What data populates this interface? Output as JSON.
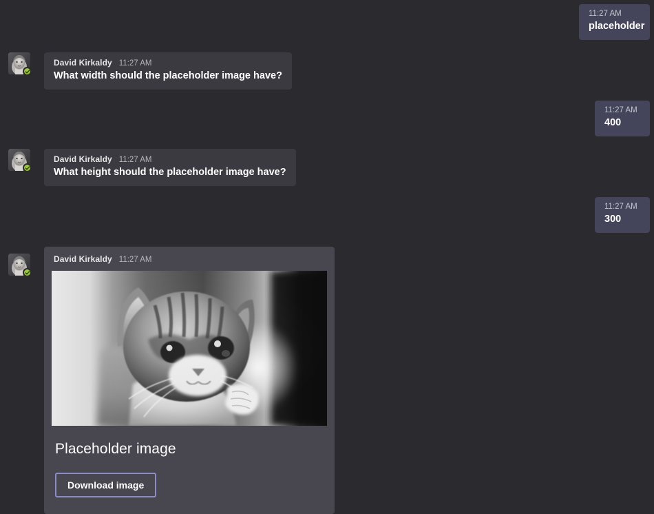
{
  "theme": {
    "page_background": "#2b2a2f",
    "incoming_bubble": "#3b3a40",
    "outgoing_bubble": "#44445b",
    "card_background": "#484750",
    "accent_button_border": "#8b8cc9",
    "presence_available": "#9bcc28"
  },
  "conversation": {
    "sender_name": "David Kirkaldy",
    "messages": [
      {
        "id": "m1",
        "direction": "outgoing",
        "time": "11:27 AM",
        "text": "placeholder"
      },
      {
        "id": "m2",
        "direction": "incoming",
        "sender": "David Kirkaldy",
        "time": "11:27 AM",
        "text": "What width should the placeholder image have?",
        "avatar_icon": "user-avatar-portrait",
        "presence_icon": "presence-available-check-icon"
      },
      {
        "id": "m3",
        "direction": "outgoing",
        "time": "11:27 AM",
        "text": "400"
      },
      {
        "id": "m4",
        "direction": "incoming",
        "sender": "David Kirkaldy",
        "time": "11:27 AM",
        "text": "What height should the placeholder image have?",
        "avatar_icon": "user-avatar-portrait",
        "presence_icon": "presence-available-check-icon"
      },
      {
        "id": "m5",
        "direction": "outgoing",
        "time": "11:27 AM",
        "text": "300"
      }
    ],
    "image_card": {
      "sender": "David Kirkaldy",
      "time": "11:27 AM",
      "title": "Placeholder image",
      "image_alt": "Grayscale photo of a kitten",
      "image_icon": "kitten-photo",
      "avatar_icon": "user-avatar-portrait",
      "presence_icon": "presence-available-check-icon",
      "button_label": "Download image"
    }
  }
}
